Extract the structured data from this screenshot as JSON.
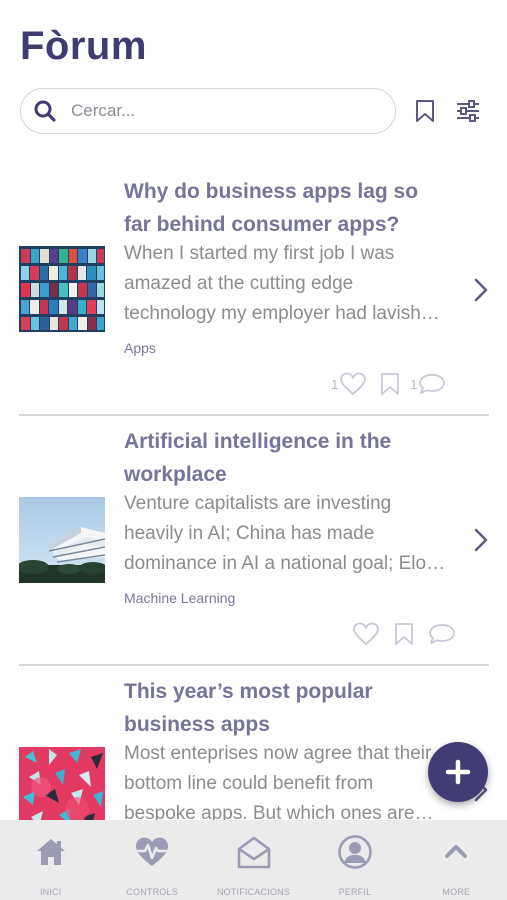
{
  "header": {
    "title": "Fòrum"
  },
  "search": {
    "placeholder": "Cercar..."
  },
  "posts": [
    {
      "title_lines": [
        "Why do business apps lag so",
        "far behind consumer apps?"
      ],
      "excerpt_lines": [
        "When I started my first job I was",
        "amazed at the cutting edge",
        "technology my employer had lavish…"
      ],
      "tag": "Apps",
      "likes": "1",
      "comments": "1"
    },
    {
      "title_lines": [
        "Artificial intelligence in the",
        "workplace"
      ],
      "excerpt_lines": [
        "Venture capitalists are investing",
        "heavily in AI; China has made",
        "dominance in AI a national goal; Elo…"
      ],
      "tag": "Machine Learning",
      "likes": "",
      "comments": ""
    },
    {
      "title_lines": [
        "This year’s most popular",
        "business apps"
      ],
      "excerpt_lines": [
        "Most enteprises now agree that their",
        "bottom line could benefit from",
        "bespoke apps. But which ones are…"
      ],
      "tag": "",
      "likes": "",
      "comments": ""
    }
  ],
  "fab": {
    "icon": "plus-icon"
  },
  "tabbar": {
    "items": [
      {
        "label": "INICI",
        "icon": "home-icon"
      },
      {
        "label": "CONTROLS",
        "icon": "heart-pulse-icon"
      },
      {
        "label": "NOTIFICACIONS",
        "icon": "envelope-open-icon"
      },
      {
        "label": "PERFIL",
        "icon": "user-circle-icon"
      },
      {
        "label": "MORE",
        "icon": "chevron-up-icon"
      }
    ]
  },
  "colors": {
    "accent": "#413d74",
    "title": "#3f3c72",
    "post_title": "#76749a",
    "icon": "#9b9bb4"
  }
}
